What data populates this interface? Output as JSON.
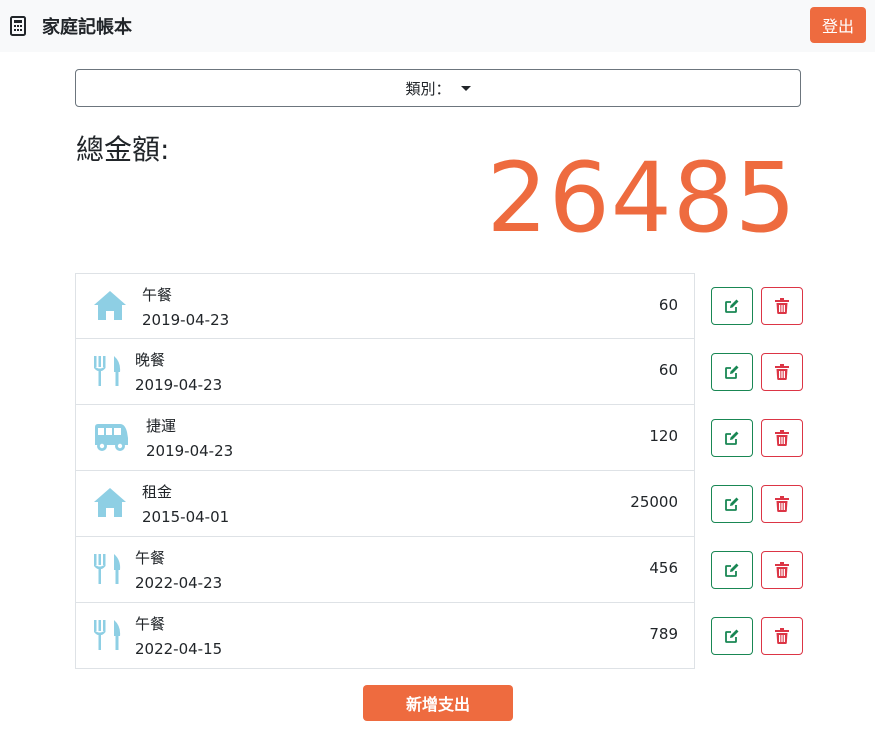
{
  "navbar": {
    "brand_icon": "calculator-icon",
    "title": "家庭記帳本",
    "logout_label": "登出"
  },
  "filter": {
    "category_label": "類別："
  },
  "summary": {
    "total_label": "總金額:",
    "total_value": "26485"
  },
  "colors": {
    "accent": "#ee6b3f",
    "icon": "#8ecfe4",
    "edit": "#198754",
    "delete": "#dc3545"
  },
  "expenses": [
    {
      "icon": "house-icon",
      "name": "午餐",
      "date": "2019-04-23",
      "amount": "60"
    },
    {
      "icon": "utensils-icon",
      "name": "晚餐",
      "date": "2019-04-23",
      "amount": "60"
    },
    {
      "icon": "bus-icon",
      "name": "捷運",
      "date": "2019-04-23",
      "amount": "120"
    },
    {
      "icon": "house-icon",
      "name": "租金",
      "date": "2015-04-01",
      "amount": "25000"
    },
    {
      "icon": "utensils-icon",
      "name": "午餐",
      "date": "2022-04-23",
      "amount": "456"
    },
    {
      "icon": "utensils-icon",
      "name": "午餐",
      "date": "2022-04-15",
      "amount": "789"
    }
  ],
  "row_actions": {
    "edit_icon": "edit-icon",
    "delete_icon": "trash-icon"
  },
  "add_button_label": "新增支出"
}
